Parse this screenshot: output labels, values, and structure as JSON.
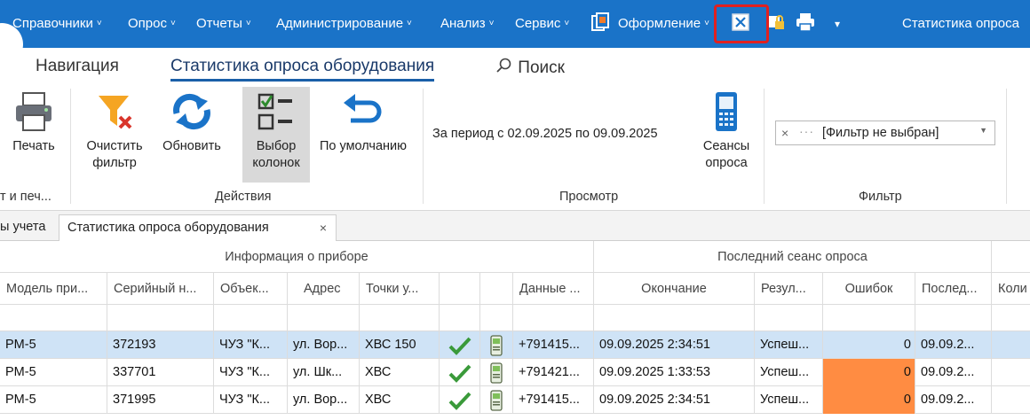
{
  "menubar": {
    "items": [
      {
        "label": "Справочники"
      },
      {
        "label": "Опрос"
      },
      {
        "label": "Отчеты"
      },
      {
        "label": "Администрирование"
      },
      {
        "label": "Анализ"
      },
      {
        "label": "Сервис"
      },
      {
        "label": "Оформление"
      }
    ],
    "title": "Статистика опроса",
    "chevron": "˅",
    "dropdown_glyph": "▾"
  },
  "ribbon_tabs": {
    "navigation": "Навигация",
    "active": "Статистика опроса оборудования",
    "search": "Поиск"
  },
  "ribbon": {
    "print": "Печать",
    "print_group": "т и печ...",
    "clear_filter_1": "Очистить",
    "clear_filter_2": "фильтр",
    "refresh": "Обновить",
    "column_choice_1": "Выбор",
    "column_choice_2": "колонок",
    "default": "По умолчанию",
    "actions_group": "Действия",
    "period": "За период с 02.09.2025 по 09.09.2025",
    "sessions_1": "Сеансы",
    "sessions_2": "опроса",
    "view_group": "Просмотр",
    "filter_clear": "×",
    "filter_dots": "···",
    "filter_value": "[Фильтр не выбран]",
    "filter_dd": "▼",
    "filter_group": "Фильтр"
  },
  "doc_tabs": {
    "inactive": "ы учета",
    "active": "Статистика опроса оборудования",
    "close": "×"
  },
  "grid": {
    "band_device": "Информация о приборе",
    "band_session": "Последний сеанс опроса",
    "columns": {
      "model": "Модель при...",
      "serial": "Серийный н...",
      "object": "Объек...",
      "address": "Адрес",
      "points": "Точки у...",
      "data": "Данные ...",
      "end": "Окончание",
      "result": "Резул...",
      "errors": "Ошибок",
      "last": "Послед...",
      "count": "Коли"
    },
    "rows": [
      {
        "model": "PM-5",
        "serial": "372193",
        "object": "ЧУЗ \"К...",
        "address": "ул. Вор...",
        "points": "ХВС 150",
        "data": "+791415...",
        "end": "09.09.2025 2:34:51",
        "result": "Успеш...",
        "errors": "0",
        "last": "09.09.2..."
      },
      {
        "model": "PM-5",
        "serial": "337701",
        "object": "ЧУЗ \"К...",
        "address": "ул. Шк...",
        "points": "ХВС",
        "data": "+791421...",
        "end": "09.09.2025 1:33:53",
        "result": "Успеш...",
        "errors": "0",
        "last": "09.09.2..."
      },
      {
        "model": "PM-5",
        "serial": "371995",
        "object": "ЧУЗ \"К...",
        "address": "ул. Вор...",
        "points": "ХВС",
        "data": "+791415...",
        "end": "09.09.2025 2:34:51",
        "result": "Успеш...",
        "errors": "0",
        "last": "09.09.2..."
      }
    ]
  },
  "colors": {
    "menubar": "#1a73c8",
    "selected_row": "#cfe3f6",
    "error_cell": "#ff8c42",
    "highlight": "#e02020",
    "check": "#3a9a3a"
  },
  "icons": [
    "printer-icon",
    "filter-clear-icon",
    "refresh-icon",
    "column-choice-icon",
    "undo-icon",
    "sessions-icon",
    "search-icon",
    "check-icon",
    "meter-icon",
    "design-icon",
    "close-window-icon",
    "lock-print-icon",
    "print-icon"
  ]
}
